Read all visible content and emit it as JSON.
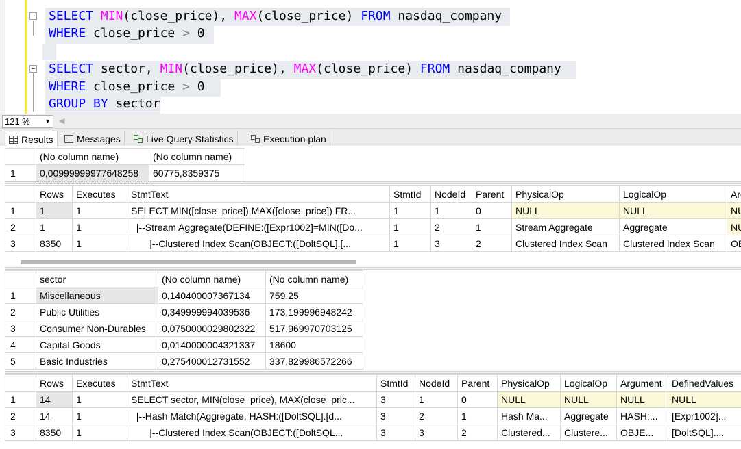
{
  "editor": {
    "q1": {
      "l1": {
        "select": "SELECT",
        "min": "MIN",
        "a1": "(close_price),",
        "max": "MAX",
        "a2": "(close_price)",
        "from": "FROM",
        "tbl": "nasdaq_company"
      },
      "l2": {
        "where": "WHERE",
        "col": "close_price",
        "gt": ">",
        "zero": "0"
      }
    },
    "q2": {
      "l1": {
        "select": "SELECT",
        "sector": "sector,",
        "min": "MIN",
        "a1": "(close_price),",
        "max": "MAX",
        "a2": "(close_price)",
        "from": "FROM",
        "tbl": "nasdaq_company"
      },
      "l2": {
        "where": "WHERE",
        "col": "close_price",
        "gt": ">",
        "zero": "0"
      },
      "l3": {
        "group": "GROUP BY",
        "col": "sector"
      }
    }
  },
  "zoom": "121 %",
  "tabs": [
    "Results",
    "Messages",
    "Live Query Statistics",
    "Execution plan"
  ],
  "grid1": {
    "headers": [
      "(No column name)",
      "(No column name)"
    ],
    "rows": [
      [
        "1",
        "0,00999999977648258",
        "60775,8359375"
      ]
    ]
  },
  "grid2": {
    "headers": [
      "Rows",
      "Executes",
      "StmtText",
      "StmtId",
      "NodeId",
      "Parent",
      "PhysicalOp",
      "LogicalOp",
      "Arg"
    ],
    "rows": [
      [
        "1",
        "1",
        "1",
        "SELECT MIN([close_price]),MAX([close_price]) FR...",
        "1",
        "1",
        "0",
        "NULL",
        "NULL",
        "NU"
      ],
      [
        "2",
        "1",
        "1",
        "  |--Stream Aggregate(DEFINE:([Expr1002]=MIN([Do...",
        "1",
        "2",
        "1",
        "Stream Aggregate",
        "Aggregate",
        "NU"
      ],
      [
        "3",
        "8350",
        "1",
        "       |--Clustered Index Scan(OBJECT:([DoltSQL].[...",
        "1",
        "3",
        "2",
        "Clustered Index Scan",
        "Clustered Index Scan",
        "OB"
      ]
    ]
  },
  "grid3": {
    "headers": [
      "sector",
      "(No column name)",
      "(No column name)"
    ],
    "rows": [
      [
        "1",
        "Miscellaneous",
        "0,140400007367134",
        "759,25"
      ],
      [
        "2",
        "Public Utilities",
        "0,349999994039536",
        "173,199996948242"
      ],
      [
        "3",
        "Consumer Non-Durables",
        "0,0750000029802322",
        "517,969970703125"
      ],
      [
        "4",
        "Capital Goods",
        "0,0140000004321337",
        "18600"
      ],
      [
        "5",
        "Basic Industries",
        "0,275400012731552",
        "337,829986572266"
      ]
    ]
  },
  "grid4": {
    "headers": [
      "Rows",
      "Executes",
      "StmtText",
      "StmtId",
      "NodeId",
      "Parent",
      "PhysicalOp",
      "LogicalOp",
      "Argument",
      "DefinedValues"
    ],
    "rows": [
      [
        "1",
        "14",
        "1",
        "SELECT sector, MIN(close_price), MAX(close_pric...",
        "3",
        "1",
        "0",
        "NULL",
        "NULL",
        "NULL",
        "NULL"
      ],
      [
        "2",
        "14",
        "1",
        "  |--Hash Match(Aggregate, HASH:([DoltSQL].[d...",
        "3",
        "2",
        "1",
        "Hash Ma...",
        "Aggregate",
        "HASH:...",
        "[Expr1002]..."
      ],
      [
        "3",
        "8350",
        "1",
        "       |--Clustered Index Scan(OBJECT:([DoltSQL...",
        "3",
        "3",
        "2",
        "Clustered...",
        "Clustere...",
        "OBJE...",
        "[DoltSQL]...."
      ]
    ]
  }
}
